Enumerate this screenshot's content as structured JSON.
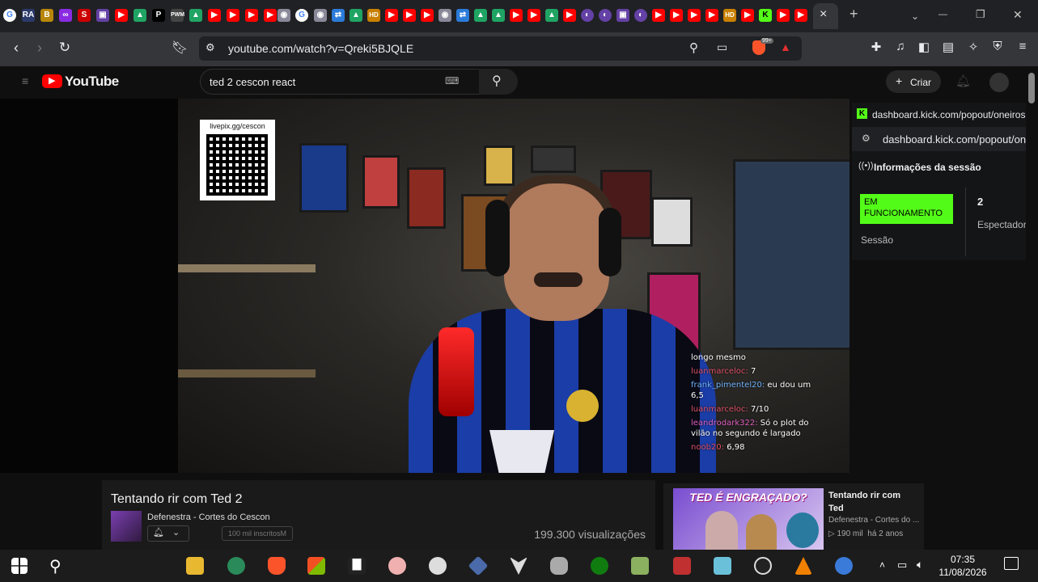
{
  "browser": {
    "url": "youtube.com/watch?v=Qreki5BJQLE",
    "tab_close": "×",
    "window_controls": {
      "minimize": "—",
      "restore": "❐",
      "close": "✕"
    },
    "new_tab": "+",
    "brave_badge": "99+"
  },
  "youtube": {
    "logo_text": "YouTube",
    "search_value": "ted 2 cescon react",
    "create_label": "Criar"
  },
  "video": {
    "qr_text": "livepix.gg/cescon",
    "chat": [
      {
        "user": "",
        "text": "longo mesmo",
        "color": "#ffffff"
      },
      {
        "user": "luanmarceloc:",
        "text": "7",
        "color": "#e0526a"
      },
      {
        "user": "frank_pimentel20:",
        "text": "eu dou um 6,5",
        "color": "#6fb4ff"
      },
      {
        "user": "luanmarceloc:",
        "text": "7/10",
        "color": "#e0526a"
      },
      {
        "user": "leandrodark322:",
        "text": "Só o plot do vilão no segundo é largado",
        "color": "#e060c0"
      },
      {
        "user": "noob20:",
        "text": "6,98",
        "color": "#e0526a"
      }
    ]
  },
  "kick": {
    "tab_url": "dashboard.kick.com/popout/oneiros-fo",
    "address": "dashboard.kick.com/popout/onei",
    "header": "Informações da sessão",
    "status": "EM FUNCIONAMENTO",
    "session_label": "Sessão",
    "viewers_count": "2",
    "viewers_label": "Espectadore"
  },
  "video_info": {
    "title": "Tentando rir com Ted 2",
    "channel": "Defenestra - Cortes do Cescon",
    "subscribers": "100 mil inscritosM",
    "views": "199.300 visualizações"
  },
  "recommended": {
    "thumb_text": "TED É ENGRAÇADO?",
    "title": "Tentando rir com Ted",
    "channel": "Defenestra - Cortes do ...",
    "views": "190 mil",
    "age": "há 2 anos"
  },
  "taskbar": {
    "time": "07:35",
    "date": "11/08/2026"
  },
  "colors": {
    "kick_green": "#53fc18",
    "youtube_red": "#ff0000",
    "brave_orange": "#fb542b"
  }
}
